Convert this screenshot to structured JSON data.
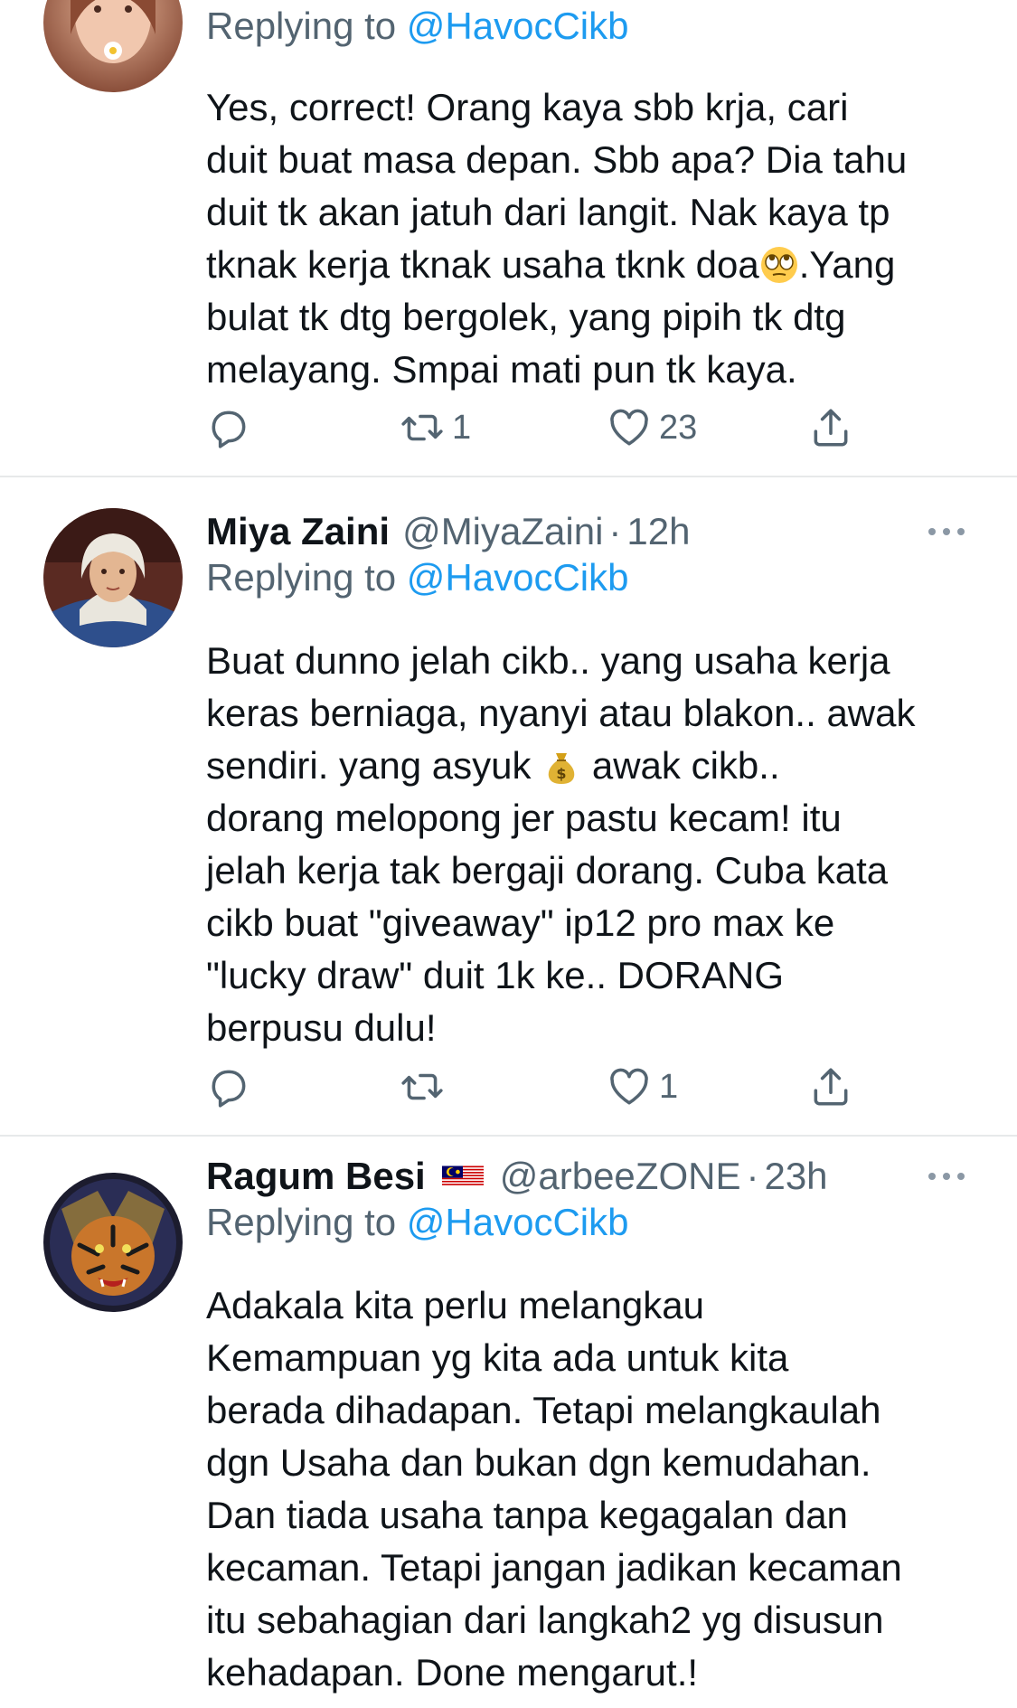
{
  "tweets": [
    {
      "replying_label": "Replying to",
      "replying_to": "@HavocCikb",
      "lines": [
        "Yes, correct! Orang kaya sbb krja, cari",
        "duit buat masa depan. Sbb apa? Dia tahu",
        "duit tk akan jatuh dari langit. Nak kaya tp",
        "tknak kerja tknak usaha tknk doa",
        "bulat tk dtg bergolek, yang pipih tk dtg",
        "melayang. Smpai mati pun tk kaya."
      ],
      "line4_after_emoji": ".Yang",
      "emoji_name": "rolling-eyes-emoji",
      "retweets": "1",
      "likes": "23"
    },
    {
      "name": "Miya Zaini",
      "handle": "@MiyaZaini",
      "separator": "·",
      "time": "12h",
      "replying_label": "Replying to",
      "replying_to": "@HavocCikb",
      "lines": [
        "Buat dunno jelah cikb.. yang usaha kerja",
        "keras berniaga, nyanyi atau blakon.. awak",
        "sendiri. yang asyuk",
        "dorang melopong jer pastu kecam! itu",
        "jelah kerja tak bergaji dorang. Cuba kata",
        "cikb buat \"giveaway\" ip12 pro max  ke",
        "\"lucky draw\" duit 1k ke.. DORANG",
        "berpusu dulu!"
      ],
      "line3_after_emoji": " awak cikb..",
      "emoji_name": "money-bag-emoji",
      "likes": "1"
    },
    {
      "name": "Ragum Besi",
      "handle": "@arbeeZONE",
      "separator": "·",
      "time": "23h",
      "flag_name": "malaysia-flag-icon",
      "replying_label": "Replying to",
      "replying_to": "@HavocCikb",
      "lines": [
        "Adakala kita perlu melangkau",
        "Kemampuan yg kita ada untuk kita",
        "berada dihadapan. Tetapi melangkaulah",
        "dgn Usaha dan bukan dgn kemudahan.",
        "Dan tiada usaha tanpa kegagalan dan",
        "kecaman. Tetapi jangan jadikan kecaman",
        "itu sebahagian dari langkah2 yg disusun",
        "kehadapan. Done mengarut.!"
      ]
    }
  ],
  "colors": {
    "text": "#0f1419",
    "secondary": "#536471",
    "link": "#1d9bf0",
    "divider": "#e7e9ea"
  }
}
